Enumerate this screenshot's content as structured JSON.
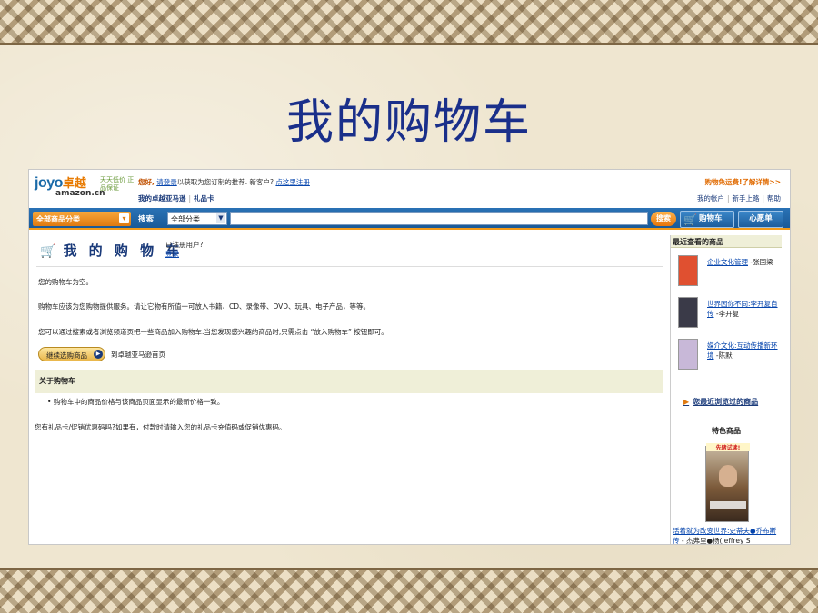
{
  "slide": {
    "title": "我的购物车"
  },
  "header": {
    "logo_joyo": "joyo",
    "logo_zhuoyue": "卓越",
    "logo_amazon": "amazon.cn",
    "logo_tagline": "天天低价 正品保证",
    "greeting_hello": "您好,",
    "greeting_signin_link": "请登录",
    "greeting_text": "以获取为您订制的推荐. 新客户?",
    "greeting_register_link": "点这里注册",
    "my_zhuoyue": "我的卓越亚马逊",
    "gift_card": "礼品卡",
    "shipping_promo": "购物免运费!了解详情>>",
    "util_links": [
      "我的帐户",
      "新手上路",
      "帮助"
    ]
  },
  "navbar": {
    "all_categories": "全部商品分类",
    "search_label": "搜索",
    "search_scope": "全部分类",
    "search_value": "",
    "search_button": "搜索",
    "cart_tab": "购物车",
    "wishlist_tab": "心愿单"
  },
  "main": {
    "heading": "我 的 购 物 车",
    "registered_prompt": "已注册用户?",
    "signin_link": "登录",
    "empty_text": "您的购物车为空。",
    "service_text": "购物车应该为您购物提供服务。请让它物有所值一可放入书籍、CD、录像带、DVD、玩具、电子产品，等等。",
    "add_hint_text": "您可以通过搜索或者浏览频道页把一些商品加入购物车.当您发现感兴趣的商品时,只需点击 “放入购物车” 按钮即可。",
    "continue_button": "继续选购商品",
    "continue_label": "到卓越亚马逊首页",
    "about_title": "关于购物车",
    "about_bullet": "购物车中的商品价格与该商品页面显示的最新价格一致。",
    "gift_card_text": "您有礼品卡/促销优惠码吗?如果有，付款时请输入您的礼品卡充值码或促销优惠码。"
  },
  "sidebar": {
    "recent_title": "最近查看的商品",
    "recent_items": [
      {
        "title": "企业文化管理",
        "author": "-张国梁",
        "cover_color": "#e05030"
      },
      {
        "title": "世界因你不同:李开复自传",
        "author": "-李开复",
        "cover_color": "#3a3a48"
      },
      {
        "title": "媒介文化:互动传播新环境",
        "author": "-陈默",
        "cover_color": "#c8b8d8"
      }
    ],
    "recent_link": "您最近浏览过的商品",
    "featured_title": "特色商品",
    "featured_try": "先睹试读!",
    "featured_item": "活着就为改变世界:史蒂夫●乔布斯传",
    "featured_item_author": "- 杰弗里●杨(Jeffrey S"
  }
}
